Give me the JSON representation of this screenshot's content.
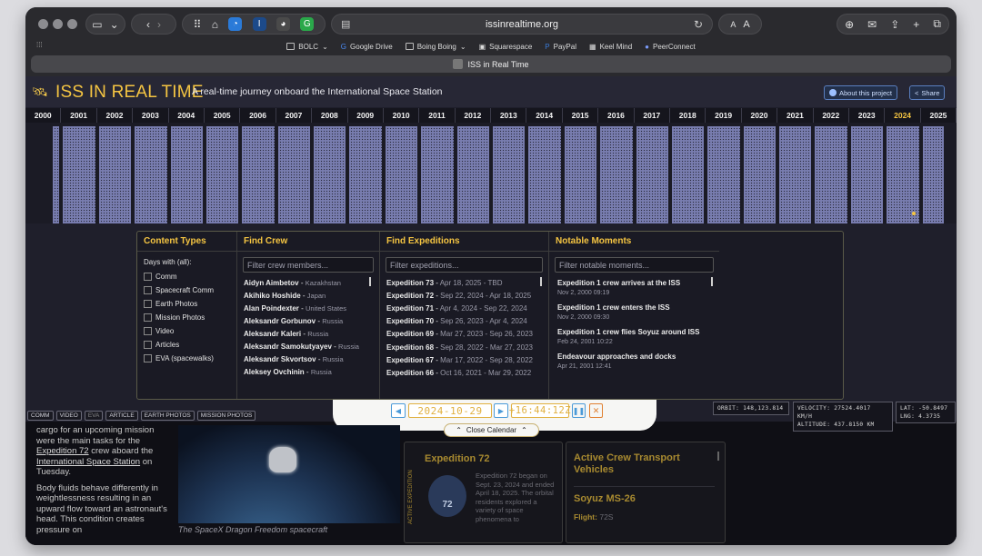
{
  "browser": {
    "url": "issinrealtime.org",
    "tab_title": "ISS in Real Time",
    "bookmarks": [
      "BOLC",
      "Google Drive",
      "Boing Boing",
      "Squarespace",
      "PayPal",
      "Keel Mind",
      "PeerConnect"
    ]
  },
  "header": {
    "title": "ISS IN REAL TIME",
    "subtitle": "A real-time journey onboard the International Space Station",
    "about_label": "About this project",
    "share_label": "Share"
  },
  "timeline": {
    "years": [
      "2000",
      "2001",
      "2002",
      "2003",
      "2004",
      "2005",
      "2006",
      "2007",
      "2008",
      "2009",
      "2010",
      "2011",
      "2012",
      "2013",
      "2014",
      "2015",
      "2016",
      "2017",
      "2018",
      "2019",
      "2020",
      "2021",
      "2022",
      "2023",
      "2024",
      "2025"
    ],
    "active_year": "2024"
  },
  "content_types": {
    "heading": "Content Types",
    "days_label": "Days with (all):",
    "options": [
      "Comm",
      "Spacecraft Comm",
      "Earth Photos",
      "Mission Photos",
      "Video",
      "Articles",
      "EVA (spacewalks)"
    ]
  },
  "find_crew": {
    "heading": "Find Crew",
    "placeholder": "Filter crew members...",
    "members": [
      {
        "name": "Aidyn Aimbetov",
        "country": "Kazakhstan"
      },
      {
        "name": "Akihiko Hoshide",
        "country": "Japan"
      },
      {
        "name": "Alan Poindexter",
        "country": "United States"
      },
      {
        "name": "Aleksandr Gorbunov",
        "country": "Russia"
      },
      {
        "name": "Aleksandr Kaleri",
        "country": "Russia"
      },
      {
        "name": "Aleksandr Samokutyayev",
        "country": "Russia"
      },
      {
        "name": "Aleksandr Skvortsov",
        "country": "Russia"
      },
      {
        "name": "Aleksey Ovchinin",
        "country": "Russia"
      }
    ]
  },
  "find_expeditions": {
    "heading": "Find Expeditions",
    "placeholder": "Filter expeditions...",
    "items": [
      {
        "name": "Expedition 73",
        "dates": "Apr 18, 2025 - TBD"
      },
      {
        "name": "Expedition 72",
        "dates": "Sep 22, 2024 - Apr 18, 2025"
      },
      {
        "name": "Expedition 71",
        "dates": "Apr 4, 2024 - Sep 22, 2024"
      },
      {
        "name": "Expedition 70",
        "dates": "Sep 26, 2023 - Apr 4, 2024"
      },
      {
        "name": "Expedition 69",
        "dates": "Mar 27, 2023 - Sep 26, 2023"
      },
      {
        "name": "Expedition 68",
        "dates": "Sep 28, 2022 - Mar 27, 2023"
      },
      {
        "name": "Expedition 67",
        "dates": "Mar 17, 2022 - Sep 28, 2022"
      },
      {
        "name": "Expedition 66",
        "dates": "Oct 16, 2021 - Mar 29, 2022"
      }
    ]
  },
  "notable_moments": {
    "heading": "Notable Moments",
    "placeholder": "Filter notable moments...",
    "items": [
      {
        "title": "Expedition 1 crew arrives at the ISS",
        "date": "Nov 2, 2000 09:19"
      },
      {
        "title": "Expedition 1 crew enters the ISS",
        "date": "Nov 2, 2000 09:30"
      },
      {
        "title": "Expedition 1 crew flies Soyuz around ISS",
        "date": "Feb 24, 2001 10:22"
      },
      {
        "title": "Endeavour approaches and docks",
        "date": "Apr 21, 2001 12:41"
      }
    ]
  },
  "tags": [
    "COMM",
    "VIDEO",
    "EVA",
    "ARTICLE",
    "EARTH PHOTOS",
    "MISSION PHOTOS"
  ],
  "controls": {
    "date": "2024-10-29",
    "time": "+16:44:12Z",
    "close_calendar": "Close Calendar"
  },
  "telemetry": {
    "orbit": "ORBIT: 148,123.814",
    "velocity": "VELOCITY: 27524.4017 KM/H",
    "altitude": "ALTITUDE: 437.8150 KM",
    "lat": "LAT: -50.8497",
    "lng": "LNG: 4.3735"
  },
  "article": {
    "line1": "cargo for an upcoming mission",
    "line2": "were the main tasks for the",
    "link1": "Expedition 72",
    "line3": " crew aboard the",
    "link2": "International Space Station",
    "line4": " on Tuesday.",
    "para2": "Body fluids behave differently in weightlessness resulting in an upward flow toward an astronaut's head. This condition creates pressure on"
  },
  "photo_caption": "The SpaceX Dragon Freedom spacecraft",
  "expedition_card": {
    "title": "Expedition 72",
    "side_label": "ACTIVE EXPEDITION",
    "badge": "72",
    "text": "Expedition 72 began on Sept. 23, 2024 and ended April 18, 2025. The orbital residents explored a variety of space phenomena to"
  },
  "vehicles_card": {
    "title": "Active Crew Transport Vehicles",
    "vehicle": "Soyuz MS-26",
    "flight_label": "Flight:",
    "flight_value": "72S"
  }
}
